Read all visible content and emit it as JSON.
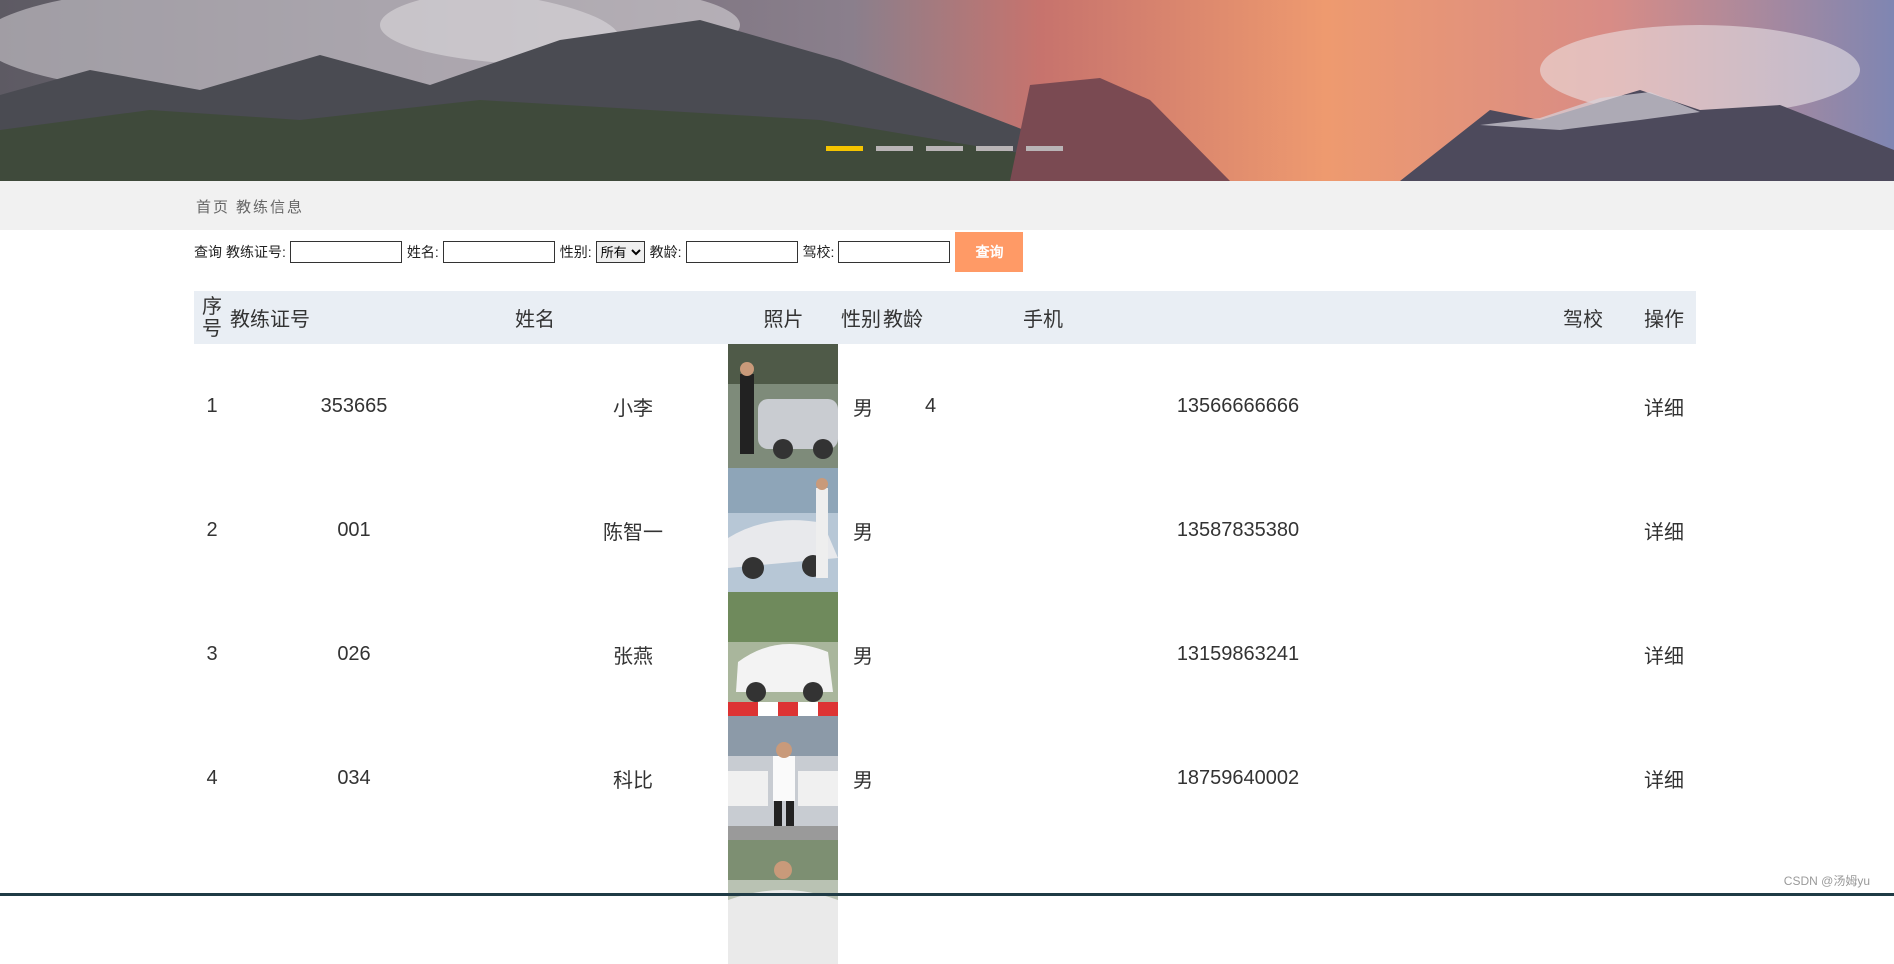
{
  "banner": {
    "slides": [
      {
        "active": true
      },
      {
        "active": false
      },
      {
        "active": false
      },
      {
        "active": false
      },
      {
        "active": false
      }
    ],
    "indicator_active_color": "#f5c400",
    "indicator_color": "#b9b4b6"
  },
  "breadcrumb": {
    "home": "首页",
    "current": "教练信息"
  },
  "search": {
    "prefix": "查询",
    "cert_label": "教练证号:",
    "cert_value": "",
    "name_label": "姓名:",
    "name_value": "",
    "gender_label": "性别:",
    "gender_selected": "所有",
    "age_label": "教龄:",
    "age_value": "",
    "school_label": "驾校:",
    "school_value": "",
    "button_label": "查询",
    "button_color": "#ff9a66"
  },
  "table": {
    "headers": {
      "index": "序号",
      "cert": "教练证号",
      "name": "姓名",
      "photo": "照片",
      "gender": "性别",
      "age": "教龄",
      "phone": "手机",
      "school": "驾校",
      "action": "操作"
    },
    "rows": [
      {
        "index": "1",
        "cert": "353665",
        "name": "小李",
        "photo": "coach-photo",
        "gender": "男",
        "age": "4",
        "phone": "13566666666",
        "school": "",
        "action": "详细"
      },
      {
        "index": "2",
        "cert": "001",
        "name": "陈智一",
        "photo": "coach-photo",
        "gender": "男",
        "age": "",
        "phone": "13587835380",
        "school": "",
        "action": "详细"
      },
      {
        "index": "3",
        "cert": "026",
        "name": "张燕",
        "photo": "coach-photo",
        "gender": "男",
        "age": "",
        "phone": "13159863241",
        "school": "",
        "action": "详细"
      },
      {
        "index": "4",
        "cert": "034",
        "name": "科比",
        "photo": "coach-photo",
        "gender": "男",
        "age": "",
        "phone": "18759640002",
        "school": "",
        "action": "详细"
      }
    ]
  },
  "watermark": "CSDN @汤姆yu"
}
